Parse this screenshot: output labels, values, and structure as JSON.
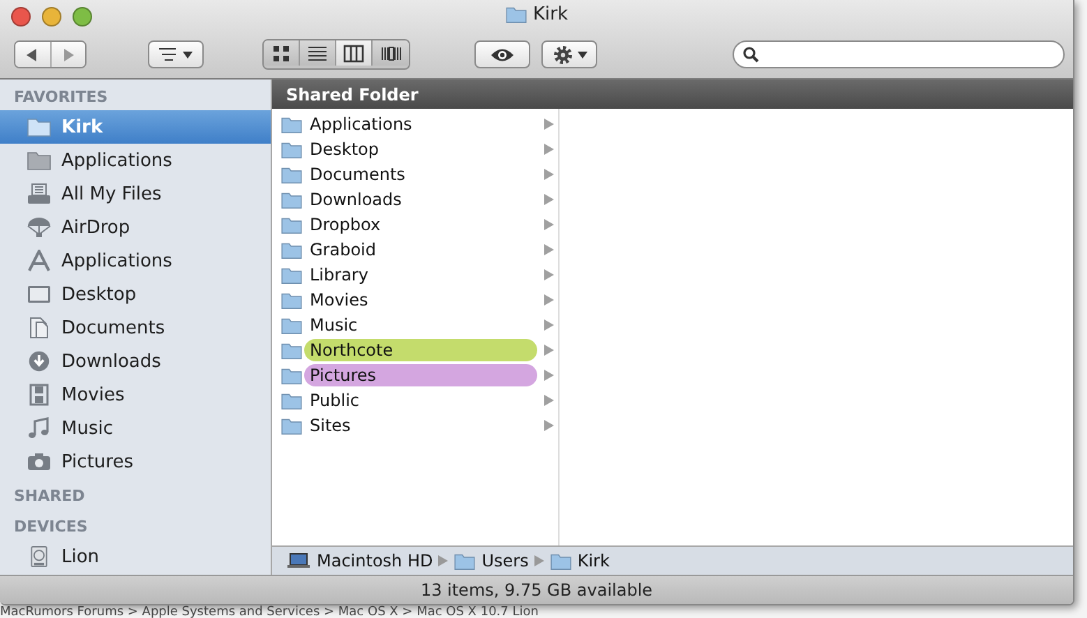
{
  "window": {
    "title": "Kirk"
  },
  "toolbar": {
    "view_modes": [
      {
        "kind": "icons",
        "selected": false
      },
      {
        "kind": "list",
        "selected": false
      },
      {
        "kind": "columns",
        "selected": true
      },
      {
        "kind": "coverflow",
        "selected": false
      }
    ]
  },
  "sidebar": {
    "sections": [
      {
        "title": "FAVORITES",
        "items": [
          {
            "label": "Kirk",
            "kind": "folder",
            "selected": true
          },
          {
            "label": "Applications",
            "kind": "folder-gray",
            "selected": false
          },
          {
            "label": "All My Files",
            "kind": "files",
            "selected": false
          },
          {
            "label": "AirDrop",
            "kind": "airdrop",
            "selected": false
          },
          {
            "label": "Applications",
            "kind": "apps",
            "selected": false
          },
          {
            "label": "Desktop",
            "kind": "desktop",
            "selected": false
          },
          {
            "label": "Documents",
            "kind": "documents",
            "selected": false
          },
          {
            "label": "Downloads",
            "kind": "downloads",
            "selected": false
          },
          {
            "label": "Movies",
            "kind": "movies",
            "selected": false
          },
          {
            "label": "Music",
            "kind": "music",
            "selected": false
          },
          {
            "label": "Pictures",
            "kind": "camera",
            "selected": false
          }
        ]
      },
      {
        "title": "SHARED"
      },
      {
        "title": "DEVICES",
        "items": [
          {
            "label": "Lion",
            "kind": "disk",
            "selected": false
          }
        ]
      }
    ]
  },
  "column_header": "Shared Folder",
  "columns": [
    {
      "items": [
        {
          "name": "Applications"
        },
        {
          "name": "Desktop"
        },
        {
          "name": "Documents"
        },
        {
          "name": "Downloads"
        },
        {
          "name": "Dropbox"
        },
        {
          "name": "Graboid"
        },
        {
          "name": "Library"
        },
        {
          "name": "Movies"
        },
        {
          "name": "Music"
        },
        {
          "name": "Northcote",
          "color": "#c4dc6c"
        },
        {
          "name": "Pictures",
          "color": "#d4a6e0"
        },
        {
          "name": "Public"
        },
        {
          "name": "Sites"
        }
      ]
    }
  ],
  "path_bar": [
    {
      "label": "Macintosh HD",
      "kind": "laptop"
    },
    {
      "label": "Users",
      "kind": "folder"
    },
    {
      "label": "Kirk",
      "kind": "folder"
    }
  ],
  "status_bar": "13 items, 9.75 GB available",
  "background_page": {
    "breadcrumb": "MacRumors Forums > Apple Systems and Services > Mac OS X > Mac OS X 10.7 Lion"
  }
}
